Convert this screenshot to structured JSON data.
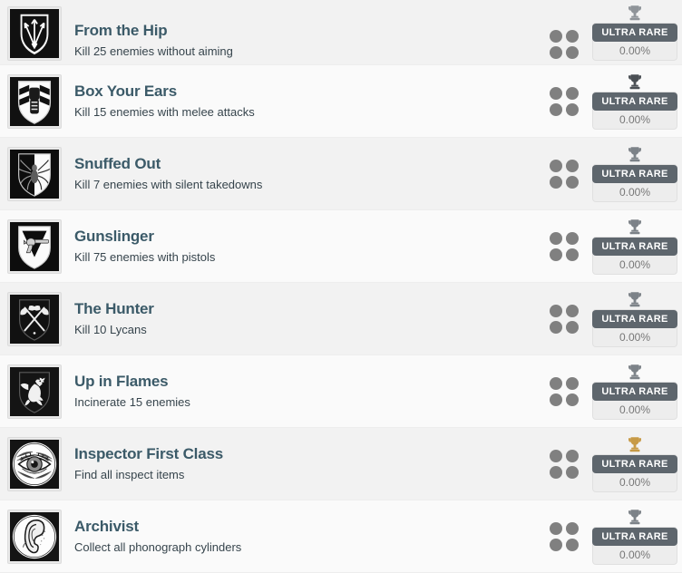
{
  "list": {
    "row_handle_icon": "four-dot-grid-icon",
    "achievements": [
      {
        "title": "From the Hip",
        "description": "Kill 25 enemies without aiming",
        "icon": "shield-arrows-icon",
        "trophy": "trophy-icon",
        "trophy_color": "#8f9499",
        "rarity": "ULTRA RARE",
        "percent": "0.00%"
      },
      {
        "title": "Box Your Ears",
        "description": "Kill 15 enemies with melee attacks",
        "icon": "shield-fist-icon",
        "trophy": "trophy-icon",
        "trophy_color": "#4a4f54",
        "rarity": "ULTRA RARE",
        "percent": "0.00%"
      },
      {
        "title": "Snuffed Out",
        "description": "Kill 7 enemies with silent takedowns",
        "icon": "shield-spider-icon",
        "trophy": "trophy-icon",
        "trophy_color": "#7c8288",
        "rarity": "ULTRA RARE",
        "percent": "0.00%"
      },
      {
        "title": "Gunslinger",
        "description": "Kill 75 enemies with pistols",
        "icon": "shield-revolver-icon",
        "trophy": "trophy-icon",
        "trophy_color": "#7c8288",
        "rarity": "ULTRA RARE",
        "percent": "0.00%"
      },
      {
        "title": "The Hunter",
        "description": "Kill 10 Lycans",
        "icon": "shield-crossed-axes-icon",
        "trophy": "trophy-icon",
        "trophy_color": "#7c8288",
        "rarity": "ULTRA RARE",
        "percent": "0.00%"
      },
      {
        "title": "Up in Flames",
        "description": "Incinerate 15 enemies",
        "icon": "shield-dragon-icon",
        "trophy": "trophy-icon",
        "trophy_color": "#7c8288",
        "rarity": "ULTRA RARE",
        "percent": "0.00%"
      },
      {
        "title": "Inspector First Class",
        "description": "Find all inspect items",
        "icon": "circle-eye-icon",
        "trophy": "trophy-icon",
        "trophy_color": "#c79a46",
        "rarity": "ULTRA RARE",
        "percent": "0.00%"
      },
      {
        "title": "Archivist",
        "description": "Collect all phonograph cylinders",
        "icon": "circle-ear-icon",
        "trophy": "trophy-icon",
        "trophy_color": "#7c8288",
        "rarity": "ULTRA RARE",
        "percent": "0.00%"
      }
    ]
  },
  "colors": {
    "title": "#3b5a68",
    "description": "#36444c",
    "row_dark": "#f2f2f2",
    "row_light": "#fafafa",
    "badge_bg": "#5e666d",
    "badge_text": "#ffffff",
    "percent_text": "#777777",
    "handle_dot": "#808080"
  }
}
